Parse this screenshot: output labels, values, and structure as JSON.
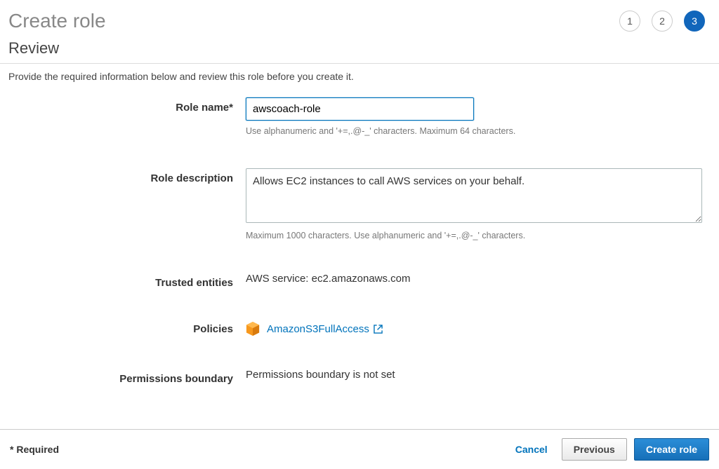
{
  "page": {
    "title": "Create role",
    "steps": [
      "1",
      "2",
      "3"
    ],
    "active_step_index": 2
  },
  "section": {
    "heading": "Review",
    "instruction": "Provide the required information below and review this role before you create it."
  },
  "form": {
    "role_name_label": "Role name*",
    "role_name_value": "awscoach-role",
    "role_name_hint": "Use alphanumeric and '+=,.@-_' characters. Maximum 64 characters.",
    "role_description_label": "Role description",
    "role_description_value": "Allows EC2 instances to call AWS services on your behalf.",
    "role_description_hint": "Maximum 1000 characters. Use alphanumeric and '+=,.@-_' characters.",
    "trusted_entities_label": "Trusted entities",
    "trusted_entities_value": "AWS service: ec2.amazonaws.com",
    "policies_label": "Policies",
    "policies": [
      {
        "icon": "policy-managed-icon",
        "name": "AmazonS3FullAccess"
      }
    ],
    "permissions_boundary_label": "Permissions boundary",
    "permissions_boundary_value": "Permissions boundary is not set"
  },
  "footer": {
    "required_note": "* Required",
    "cancel_label": "Cancel",
    "previous_label": "Previous",
    "create_label": "Create role"
  }
}
